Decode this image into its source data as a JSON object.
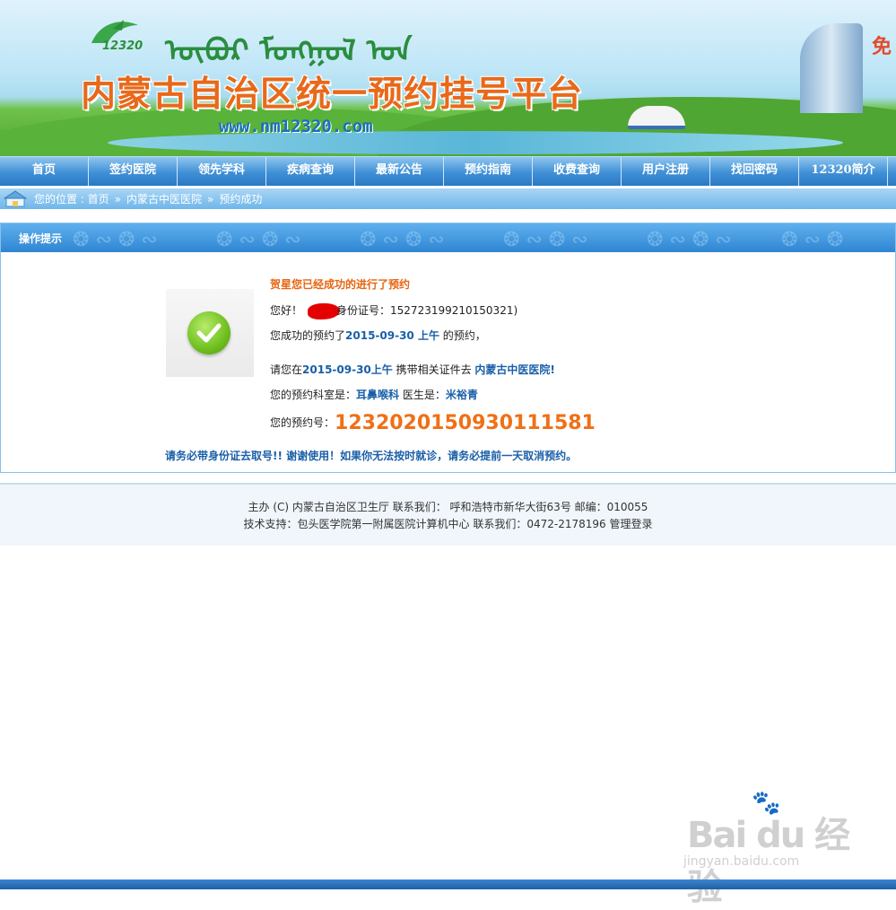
{
  "banner": {
    "logo_text": "12320",
    "mongolian_script": "ᠦᠪᠦᠷ ᠮᠣᠩᠭᠣᠯ ᠤᠨ",
    "title": "内蒙古自治区统一预约挂号平台",
    "url": "www.nm12320.com",
    "corner_text": "免"
  },
  "nav": {
    "items": [
      "首页",
      "签约医院",
      "领先学科",
      "疾病查询",
      "最新公告",
      "预约指南",
      "收费查询",
      "用户注册",
      "找回密码",
      "12320简介"
    ]
  },
  "breadcrumb": {
    "prefix": "您的位置 : 首页",
    "sep": "»",
    "hospital": "内蒙古中医医院",
    "current": "预约成功"
  },
  "panel": {
    "title": "操作提示",
    "congrats": "贺星您已经成功的进行了预约",
    "greeting_prefix": "您好！",
    "id_label": "身份证号：",
    "id_number": "152723199210150321)",
    "booked_prefix": "您成功的预约了",
    "booked_date": "2015-09-30 上午",
    "booked_suffix": " 的预约，",
    "bring_prefix": "请您在",
    "bring_date": "2015-09-30上午",
    "bring_mid": " 携带相关证件去 ",
    "bring_hospital": "内蒙古中医医院!",
    "dept_label": "您的预约科室是：",
    "dept": "耳鼻喉科",
    "doctor_label": " 医生是：",
    "doctor": "米裕青",
    "number_label": "您的预约号：",
    "number": "1232020150930111581",
    "notice": "请务必带身份证去取号!! 谢谢使用！如果你无法按时就诊，请务必提前一天取消预约。"
  },
  "footer": {
    "line1": "主办 (C) 内蒙古自治区卫生厅 联系我们： 呼和浩特市新华大街63号 邮编：010055",
    "line2_prefix": "技术支持：包头医学院第一附属医院计算机中心 联系我们：0472-2178196 ",
    "admin_login": "管理登录"
  },
  "watermark": {
    "brand": "Bai du 经验",
    "url": "jingyan.baidu.com"
  }
}
